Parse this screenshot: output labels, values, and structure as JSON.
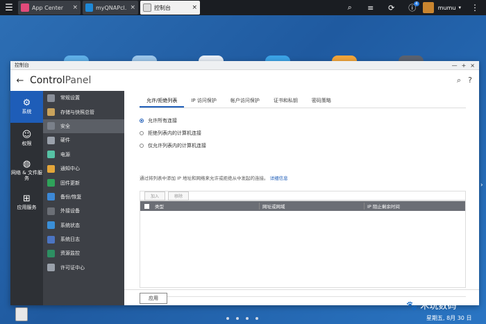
{
  "taskbar": {
    "tabs": [
      {
        "label": "App Center",
        "color": "#e14a7a"
      },
      {
        "label": "myQNAPcl…",
        "color": "#1e88d6"
      },
      {
        "label": "控制台",
        "color": "#666666"
      }
    ],
    "close_glyph": "×",
    "notification_count": "4",
    "user": "mumu"
  },
  "window": {
    "title": "控制台",
    "brand_main": "Control",
    "brand_light": "Panel",
    "controls": [
      "—",
      "+",
      "×"
    ]
  },
  "nav_primary": [
    {
      "label": "系统",
      "icon": "gear-icon",
      "active": true
    },
    {
      "label": "权限",
      "icon": "user-icon",
      "active": false
    },
    {
      "label": "网络 & 文件服务",
      "icon": "globe-icon",
      "active": false
    },
    {
      "label": "应用服务",
      "icon": "apps-icon",
      "active": false
    }
  ],
  "nav_secondary": [
    {
      "label": "常规设置",
      "color": "#8a8f99"
    },
    {
      "label": "存储与快照总管",
      "color": "#c9a35c"
    },
    {
      "label": "安全",
      "color": "#7a808a",
      "active": true
    },
    {
      "label": "硬件",
      "color": "#9aa1ab"
    },
    {
      "label": "电源",
      "color": "#56c2a5"
    },
    {
      "label": "通知中心",
      "color": "#e4a63a"
    },
    {
      "label": "固件更新",
      "color": "#2fa35a"
    },
    {
      "label": "备份/恢复",
      "color": "#3c88d6"
    },
    {
      "label": "外接设备",
      "color": "#6b6f76"
    },
    {
      "label": "系统状态",
      "color": "#3a8fd8"
    },
    {
      "label": "系统日志",
      "color": "#4b74c2"
    },
    {
      "label": "资源监控",
      "color": "#2d8f62"
    },
    {
      "label": "许可证中心",
      "color": "#9aa1ab"
    }
  ],
  "content": {
    "tabs": [
      "允许/拒绝列表",
      "IP 访问保护",
      "帐户访问保护",
      "证书和私钥",
      "密码策略"
    ],
    "active_tab": 0,
    "radios": [
      "允许所有连接",
      "拒绝列表内的计算机连接",
      "仅允许列表内的计算机连接"
    ],
    "selected_radio": 0,
    "description": "通过将列表中添加 IP 地址和网络来允许或拒绝从中发起的连接。",
    "detail_link": "详细信息",
    "add_label": "加入",
    "remove_label": "移除",
    "columns": [
      "类型",
      "网址或网域",
      "IP 阻止剩余时间"
    ],
    "apply_label": "应用"
  },
  "desktop": {
    "watermark": "🐾 木玩数码",
    "date": "星期五, 8月 30 日"
  }
}
